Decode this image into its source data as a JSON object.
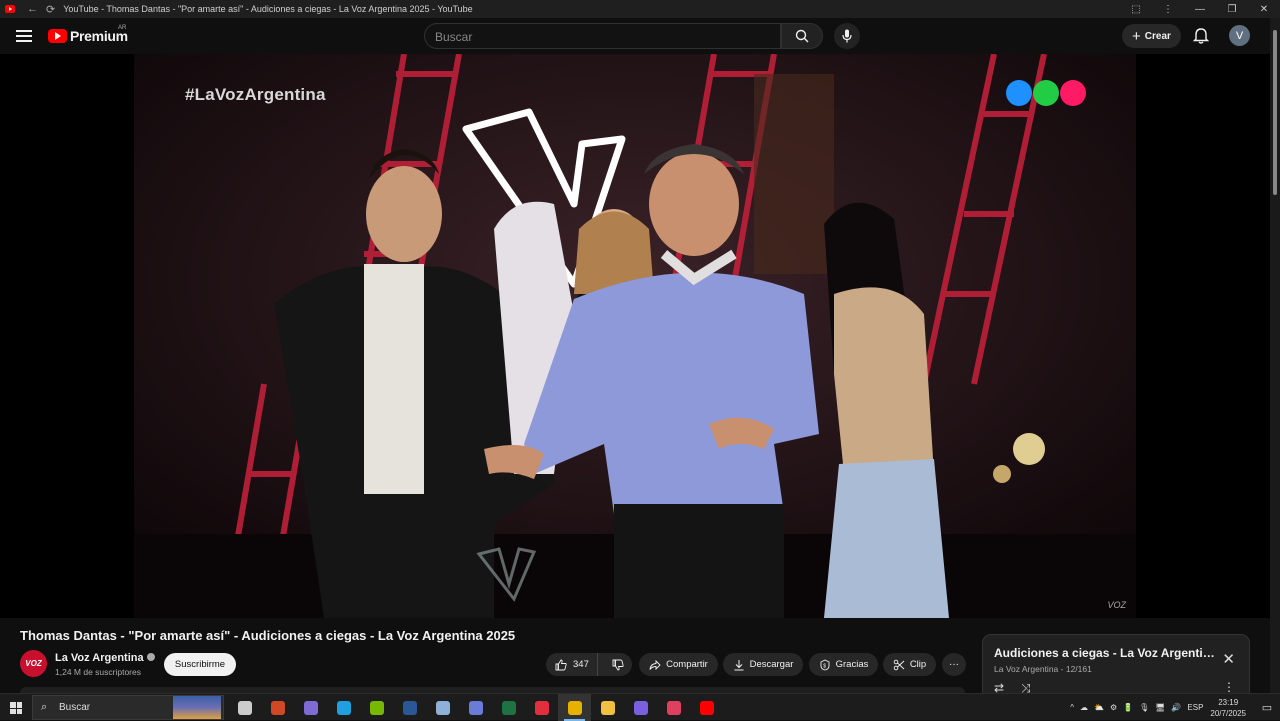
{
  "window": {
    "title": "YouTube - Thomas Dantas - \"Por amarte así\" - Audiciones a ciegas - La Voz Argentina 2025 - YouTube",
    "back_glyph": "←",
    "reload_glyph": "⟳",
    "controls": [
      "⬚",
      "⋮",
      "—",
      "❐",
      "✕"
    ]
  },
  "youtube": {
    "logo_text": "Premium",
    "country_code": "AR",
    "search_placeholder": "Buscar",
    "create_label": "Crear",
    "create_plus": "+",
    "avatar_initial": "V"
  },
  "video": {
    "overlay_hashtag": "#LaVozArgentina",
    "channel_dots": [
      "#1e90ff",
      "#22cc44",
      "#ff1a66"
    ],
    "corner_mark": "VOZ"
  },
  "info": {
    "title": "Thomas Dantas - \"Por amarte así\" - Audiciones a ciegas - La Voz Argentina 2025",
    "channel_name": "La Voz Argentina",
    "channel_avatar_text": "VOZ",
    "subscribers": "1,24 M de suscriptores",
    "subscribe_label": "Suscribirme",
    "likes": "347",
    "share_label": "Compartir",
    "download_label": "Descargar",
    "thanks_label": "Gracias",
    "clip_label": "Clip",
    "more_glyph": "···"
  },
  "playlist": {
    "title": "Audiciones a ciegas - La Voz Argentina...",
    "channel": "La Voz Argentina",
    "position": "12/161",
    "loop_glyph": "⇄",
    "shuffle_glyph": "⤨",
    "close_glyph": "✕",
    "more_glyph": "⋮"
  },
  "taskbar": {
    "search_label": "Buscar",
    "search_glyph": "⌕",
    "apps": [
      {
        "name": "task-view",
        "color": "#cccccc"
      },
      {
        "name": "powerpoint",
        "color": "#d24726"
      },
      {
        "name": "copilot",
        "color": "#7f6bd6"
      },
      {
        "name": "edge",
        "color": "#1fa0e0"
      },
      {
        "name": "nvidia",
        "color": "#76b900"
      },
      {
        "name": "word",
        "color": "#2b5797"
      },
      {
        "name": "app-cloud",
        "color": "#8fb0d8"
      },
      {
        "name": "app-doc",
        "color": "#6a7cd8"
      },
      {
        "name": "excel",
        "color": "#1f7244"
      },
      {
        "name": "app-red",
        "color": "#e03040"
      },
      {
        "name": "chrome",
        "color": "#e8b000"
      },
      {
        "name": "explorer",
        "color": "#f0c040"
      },
      {
        "name": "app-purple",
        "color": "#7a5fe0"
      },
      {
        "name": "app-gauge",
        "color": "#e04060"
      },
      {
        "name": "youtube",
        "color": "#ff0000"
      }
    ],
    "active_app": "chrome",
    "tray_icons": [
      "^",
      "☁",
      "⛅",
      "⚙",
      "🔋",
      "🎙",
      "🖥",
      "🔊"
    ],
    "language": "ESP",
    "time": "23:19",
    "date": "20/7/2025",
    "notification_glyph": "▭"
  }
}
